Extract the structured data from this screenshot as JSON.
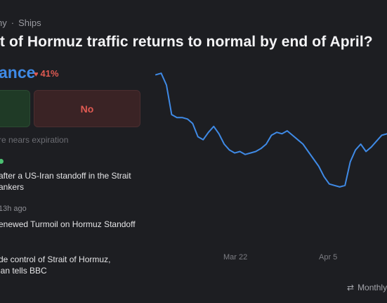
{
  "breadcrumb": {
    "first": "ny",
    "second": "Ships"
  },
  "market": {
    "title": "it of Hormuz traffic returns to normal by end of April?",
    "chance_label": "ance",
    "change": "41%"
  },
  "buttons": {
    "yes_label": "",
    "no_label": "No"
  },
  "expiry_note": "re nears expiration",
  "news": [
    {
      "meta": "",
      "title": "after a US-Iran standoff in the Strait\nankers"
    },
    {
      "meta": "13h ago",
      "title": "enewed Turmoil on Hormuz Standoff"
    },
    {
      "meta": "",
      "title": "de control of Strait of Hormuz,\nian tells BBC"
    }
  ],
  "chart_data": {
    "type": "line",
    "x_ticks": [
      "Mar 22",
      "Apr 5"
    ],
    "series": [
      {
        "color": "#3f8ae6",
        "values": [
          97,
          98,
          90,
          70,
          68,
          68,
          67,
          64,
          55,
          53,
          58,
          62,
          57,
          50,
          46,
          44,
          45,
          43,
          44,
          45,
          47,
          50,
          56,
          58,
          57,
          59,
          56,
          53,
          50,
          45,
          40,
          35,
          28,
          23,
          22,
          21,
          22,
          38,
          46,
          50,
          45,
          48,
          52,
          56,
          57
        ]
      }
    ],
    "ylim": [
      0,
      100
    ],
    "grid": false,
    "legend": false
  },
  "controls": {
    "range_label": "Monthly"
  },
  "colors": {
    "accent": "#3f8ae6",
    "yes": "#4cc072",
    "no": "#e05a52",
    "background": "#1d1e22"
  }
}
